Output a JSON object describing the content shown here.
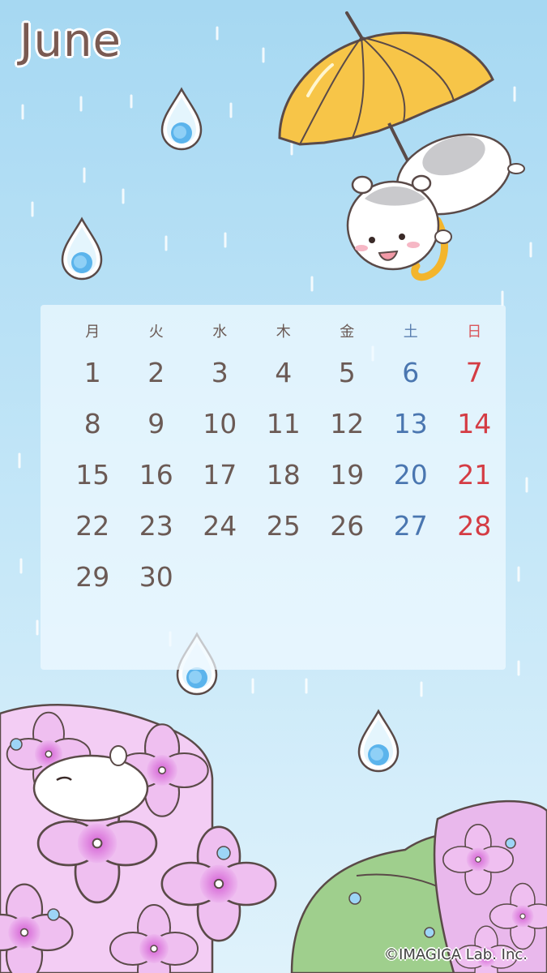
{
  "month": "June",
  "weekdays": [
    "月",
    "火",
    "水",
    "木",
    "金",
    "土",
    "日"
  ],
  "weeks": [
    [
      "1",
      "2",
      "3",
      "4",
      "5",
      "6",
      "7"
    ],
    [
      "8",
      "9",
      "10",
      "11",
      "12",
      "13",
      "14"
    ],
    [
      "15",
      "16",
      "17",
      "18",
      "19",
      "20",
      "21"
    ],
    [
      "22",
      "23",
      "24",
      "25",
      "26",
      "27",
      "28"
    ],
    [
      "29",
      "30",
      "",
      "",
      "",
      "",
      ""
    ]
  ],
  "copyright": "©IMAGICA Lab. Inc.",
  "colors": {
    "sky_top": "#a9d9f2",
    "weekday_text": "#6b5a55",
    "saturday": "#4a76b0",
    "sunday": "#d43c44",
    "umbrella": "#f7c548",
    "hydrangea": "#e7a6e8"
  },
  "illustrations": [
    "raindrop-icon",
    "umbrella-icon",
    "hamster-icon",
    "hydrangea-icon"
  ]
}
